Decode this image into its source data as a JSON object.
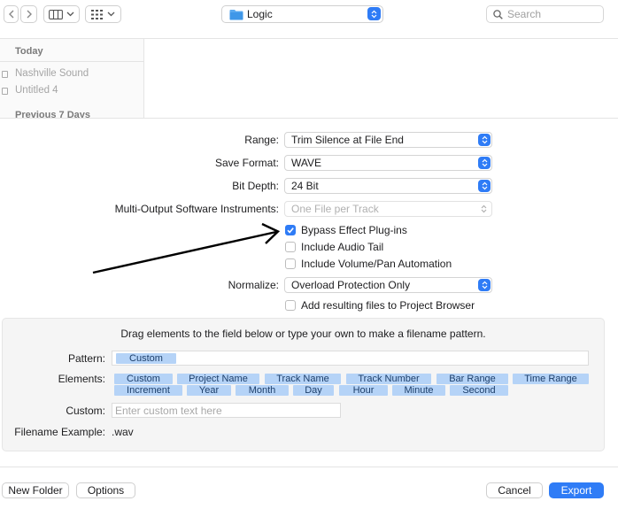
{
  "toolbar": {
    "back_icon": "chevron-left-icon",
    "forward_icon": "chevron-right-icon",
    "view_icon": "columns-view-icon",
    "group_icon": "grid-view-icon",
    "folder_name": "Logic",
    "search_placeholder": "Search"
  },
  "sidebar": {
    "sections": [
      {
        "header": "Today",
        "items": [
          "Nashville Sound",
          "Untitled 4"
        ]
      },
      {
        "header": "Previous 7 Days",
        "items": []
      }
    ]
  },
  "form": {
    "range_label": "Range:",
    "range_value": "Trim Silence at File End",
    "format_label": "Save Format:",
    "format_value": "WAVE",
    "bitdepth_label": "Bit Depth:",
    "bitdepth_value": "24 Bit",
    "multi_label": "Multi-Output Software Instruments:",
    "multi_value": "One File per Track",
    "checkboxes": [
      {
        "label": "Bypass Effect Plug-ins",
        "checked": true
      },
      {
        "label": "Include Audio Tail",
        "checked": false
      },
      {
        "label": "Include Volume/Pan Automation",
        "checked": false
      }
    ],
    "normalize_label": "Normalize:",
    "normalize_value": "Overload Protection Only",
    "add_to_browser_label": "Add resulting files to Project Browser",
    "add_to_browser_checked": false
  },
  "pattern": {
    "instruction": "Drag elements to the field below or type your own to make a filename pattern.",
    "pattern_label": "Pattern:",
    "pattern_tokens": [
      "Custom"
    ],
    "elements_label": "Elements:",
    "elements_row1": [
      "Custom",
      "Project Name",
      "Track Name",
      "Track Number",
      "Bar Range",
      "Time Range"
    ],
    "elements_row2": [
      "Increment",
      "Year",
      "Month",
      "Day",
      "Hour",
      "Minute",
      "Second"
    ],
    "custom_label": "Custom:",
    "custom_placeholder": "Enter custom text here",
    "example_label": "Filename Example:",
    "example_value": ".wav"
  },
  "buttons": {
    "new_folder": "New Folder",
    "options": "Options",
    "cancel": "Cancel",
    "export": "Export"
  },
  "colors": {
    "accent": "#2f7cf6",
    "token": "#b5d3f7"
  }
}
